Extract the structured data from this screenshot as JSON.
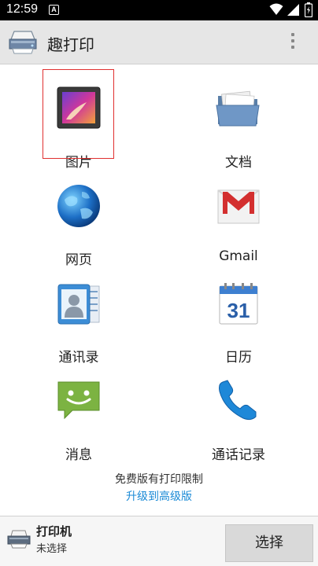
{
  "status_bar": {
    "time": "12:59",
    "notification_letter": "A"
  },
  "app_bar": {
    "title": "趣打印"
  },
  "grid": {
    "items": [
      {
        "label": "图片",
        "icon": "picture-icon"
      },
      {
        "label": "文档",
        "icon": "folder-icon"
      },
      {
        "label": "网页",
        "icon": "globe-icon"
      },
      {
        "label": "Gmail",
        "icon": "gmail-icon"
      },
      {
        "label": "通讯录",
        "icon": "contacts-icon"
      },
      {
        "label": "日历",
        "icon": "calendar-icon",
        "icon_text": "31"
      },
      {
        "label": "消息",
        "icon": "message-icon"
      },
      {
        "label": "通话记录",
        "icon": "phone-icon"
      }
    ],
    "selected_label": "图片"
  },
  "promo": {
    "limit_text": "免费版有打印限制",
    "upgrade_link": "升级到高级版"
  },
  "bottom_bar": {
    "printer_title": "打印机",
    "printer_status": "未选择",
    "select_button": "选择"
  },
  "colors": {
    "accent_link": "#1a8ad6",
    "selection_border": "#e03030",
    "app_bar_bg": "#e6e6e6"
  }
}
